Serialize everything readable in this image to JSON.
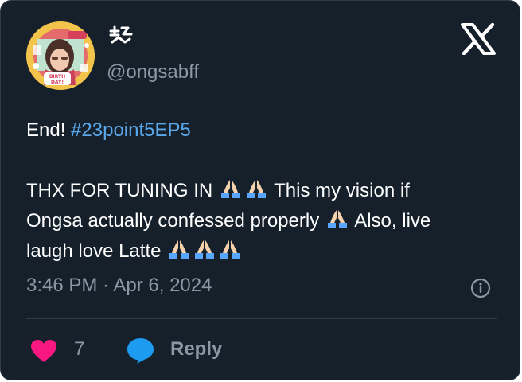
{
  "tweet": {
    "handle": "@ongsabff",
    "text": {
      "p1_prefix": "End! ",
      "hashtag": "#23point5EP5",
      "l1": "THX FOR TUNING IN",
      "l1b": "This my vision if",
      "l2": "Ongsa actually confessed properly",
      "l2b": "Also, live",
      "l3": "laugh love Latte"
    },
    "timestamp": "3:46 PM · Apr 6, 2024",
    "likes": "7",
    "reply_label": "Reply",
    "avatar_badge_text": "BIRTH DAY!"
  },
  "colors": {
    "background": "#15202b",
    "text": "#ffffff",
    "secondary": "#8b98a5",
    "link": "#5aa8ea",
    "heart": "#f91880",
    "reply": "#1d9bf0"
  },
  "icons": {
    "brand": "x-logo-icon",
    "info": "info-icon",
    "like": "heart-icon",
    "reply": "speech-bubble-icon",
    "emoji": "folded-hands-emoji"
  }
}
